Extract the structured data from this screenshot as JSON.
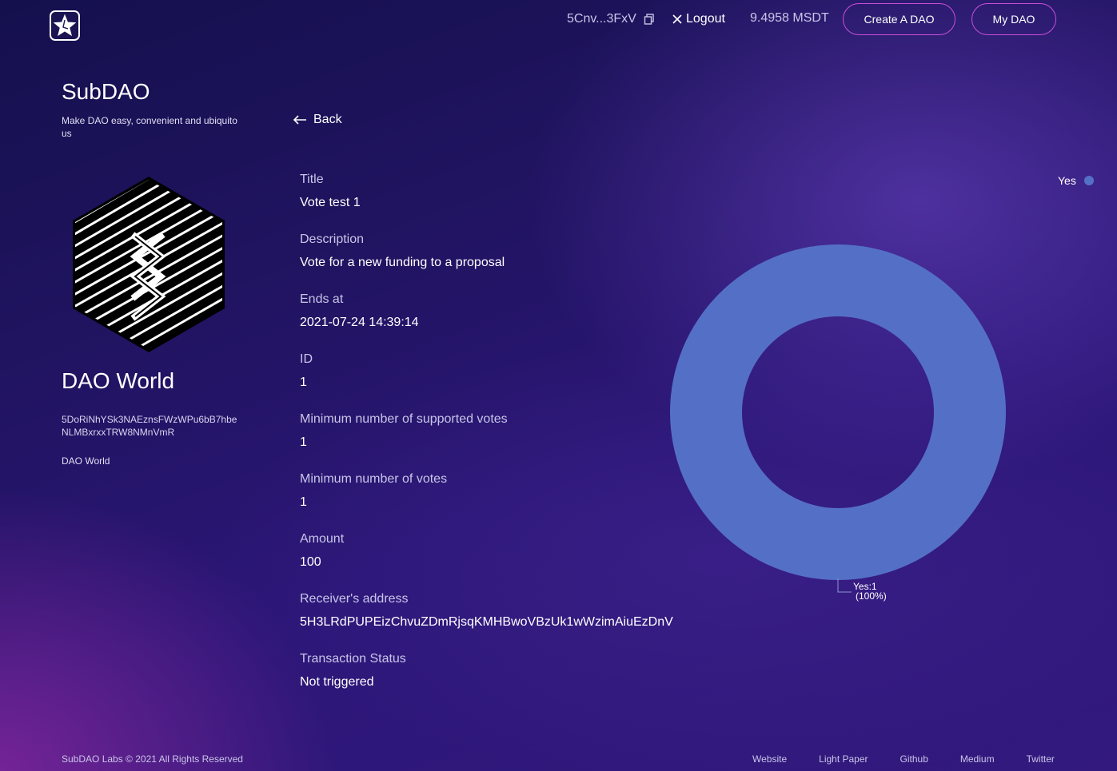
{
  "header": {
    "wallet_address": "5Cnv...3FxV",
    "logout_label": "Logout",
    "balance": "9.4958 MSDT",
    "create_dao_label": "Create A DAO",
    "my_dao_label": "My DAO",
    "icons": [
      "star-logo-icon",
      "copy-icon",
      "close-icon"
    ]
  },
  "sidebar": {
    "brand": "SubDAO",
    "tagline": "Make DAO easy, convenient and ubiquito us",
    "dao_name": "DAO World",
    "dao_address": "5DoRiNhYSk3NAEznsFWzWPu6bB7hbeNLMBxrxxTRW8NMnVmR",
    "dao_description": "DAO World"
  },
  "main": {
    "back_label": "Back",
    "fields": [
      {
        "label": "Title",
        "value": "Vote test 1"
      },
      {
        "label": "Description",
        "value": "Vote for a new funding to a proposal"
      },
      {
        "label": "Ends at",
        "value": "2021-07-24 14:39:14"
      },
      {
        "label": "ID",
        "value": "1"
      },
      {
        "label": "Minimum number of supported votes",
        "value": "1"
      },
      {
        "label": "Minimum number of votes",
        "value": "1"
      },
      {
        "label": "Amount",
        "value": "100"
      },
      {
        "label": "Receiver's address",
        "value": "5H3LRdPUPEizChvuZDmRjsqKMHBwoVBzUk1wWzimAiuEzDnV"
      },
      {
        "label": "Transaction Status",
        "value": "Not triggered"
      }
    ]
  },
  "chart_data": {
    "type": "pie",
    "donut": true,
    "categories": [
      "Yes"
    ],
    "values": [
      1
    ],
    "percentages": [
      "100%"
    ],
    "slice_labels": [
      "Yes:1",
      "(100%)"
    ],
    "legend": [
      "Yes"
    ],
    "legend_position": "top-right",
    "colors": [
      "#5470c6"
    ]
  },
  "footer": {
    "copyright": "SubDAO Labs © 2021 All Rights Reserved",
    "links": [
      "Website",
      "Light Paper",
      "Github",
      "Medium",
      "Twitter"
    ]
  }
}
